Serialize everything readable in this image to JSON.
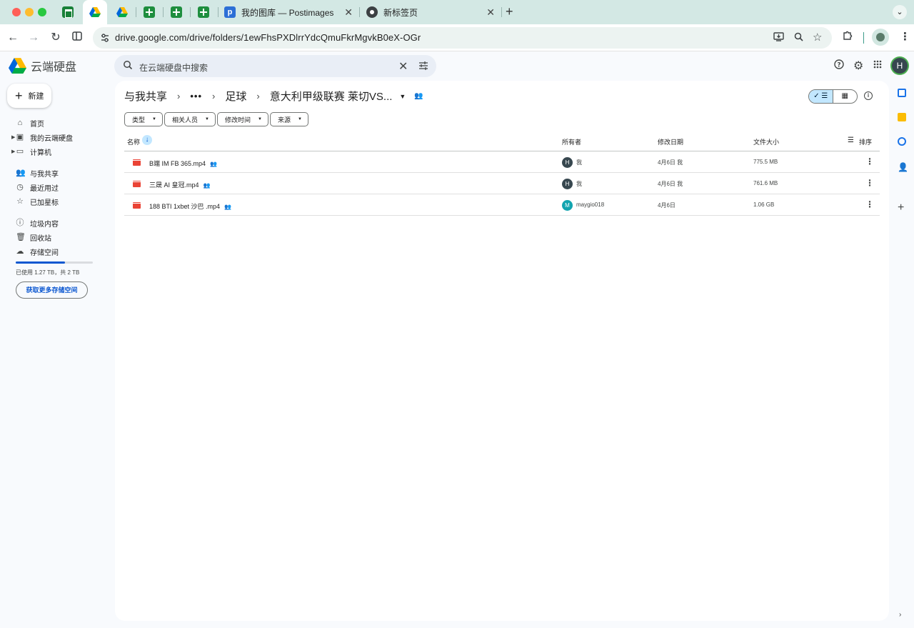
{
  "browser": {
    "tabs": [
      {
        "icon": "sheets-icon",
        "title": ""
      },
      {
        "icon": "drive-icon",
        "title": ""
      },
      {
        "icon": "drive-icon",
        "title": ""
      },
      {
        "icon": "sheets-plus-icon",
        "title": ""
      },
      {
        "icon": "sheets-plus-icon",
        "title": ""
      },
      {
        "icon": "sheets-plus-icon",
        "title": ""
      },
      {
        "icon": "postimages-icon",
        "title": "我的图库 — Postimages"
      },
      {
        "icon": "chrome-icon",
        "title": "新标签页"
      }
    ],
    "url": "drive.google.com/drive/folders/1ewFhsPXDlrrYdcQmuFkrMgvkB0eX-OGr"
  },
  "header": {
    "app_title": "云端硬盘",
    "search_placeholder": "在云端硬盘中搜索",
    "avatar_letter": "H"
  },
  "sidebar": {
    "new_label": "新建",
    "items": [
      {
        "label": "首页",
        "icon": "home-icon"
      },
      {
        "label": "我的云端硬盘",
        "icon": "my-drive-icon"
      },
      {
        "label": "计算机",
        "icon": "computer-icon"
      },
      {
        "label": "与我共享",
        "icon": "shared-icon"
      },
      {
        "label": "最近用过",
        "icon": "clock-icon"
      },
      {
        "label": "已加星标",
        "icon": "star-icon"
      },
      {
        "label": "垃圾内容",
        "icon": "spam-icon"
      },
      {
        "label": "回收站",
        "icon": "trash-icon"
      },
      {
        "label": "存储空间",
        "icon": "cloud-icon"
      }
    ],
    "storage_used_fraction": 0.635,
    "storage_text": "已使用 1.27 TB，共 2 TB",
    "get_more_label": "获取更多存储空间"
  },
  "breadcrumb": {
    "root": "与我共享",
    "ellipsis": "•••",
    "parent": "足球",
    "current": "意大利甲级联赛 莱切VS..."
  },
  "filters": [
    "类型",
    "相关人员",
    "修改时间",
    "来源"
  ],
  "table": {
    "columns": {
      "name": "名称",
      "owner": "所有者",
      "modified": "修改日期",
      "size": "文件大小",
      "sort": "排序"
    },
    "rows": [
      {
        "name": "B端 IM FB 365.mp4",
        "owner": "我",
        "owner_letter": "H",
        "owner_color": "#37474f",
        "modified": "4月6日 我",
        "size": "775.5 MB"
      },
      {
        "name": "三晟 AI 皇冠.mp4",
        "owner": "我",
        "owner_letter": "H",
        "owner_color": "#37474f",
        "modified": "4月6日 我",
        "size": "761.6 MB"
      },
      {
        "name": "188 BTI 1xbet 沙巴 .mp4",
        "owner": "maygio018",
        "owner_letter": "M",
        "owner_color": "#12a4af",
        "modified": "4月6日",
        "size": "1.06 GB"
      }
    ]
  },
  "colors": {
    "accent": "#0b57d0",
    "selected": "#c2e7ff",
    "tabbar": "#d3e8e4"
  }
}
